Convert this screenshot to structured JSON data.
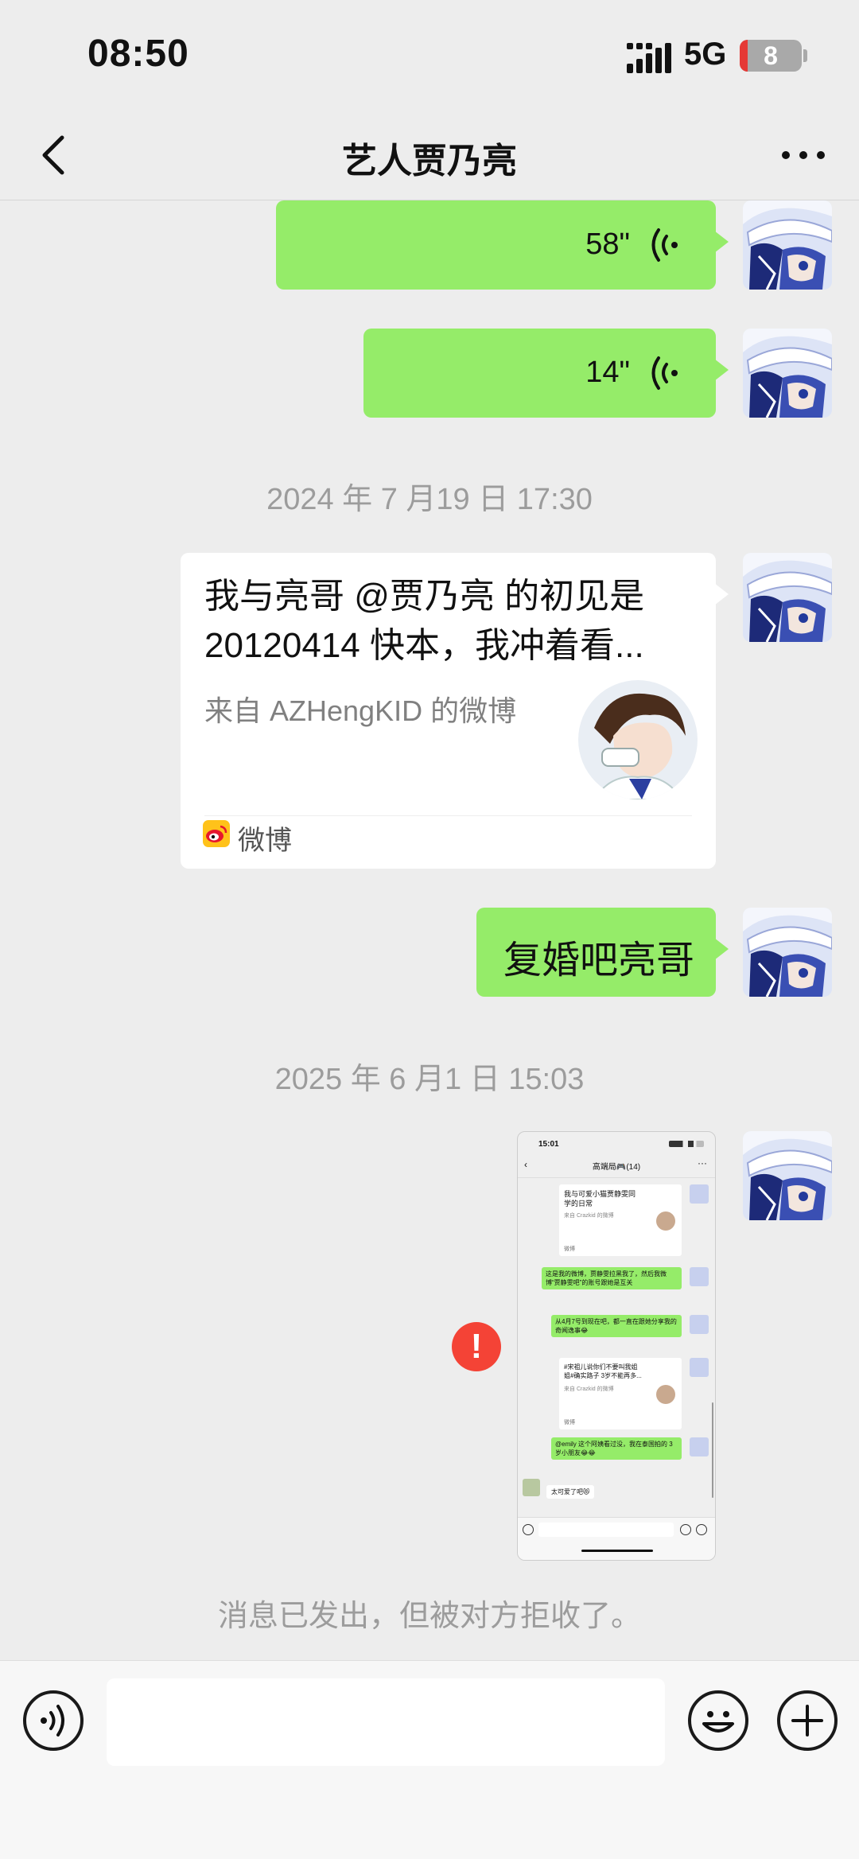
{
  "status_bar": {
    "time": "08:50",
    "network": "5G",
    "battery": "8"
  },
  "header": {
    "title": "艺人贾乃亮"
  },
  "messages": {
    "voice1": {
      "duration": "58\""
    },
    "voice2": {
      "duration": "14\""
    },
    "timestamp1": "2024 年 7 月19 日 17:30",
    "card": {
      "title": "我与亮哥 @贾乃亮 的初见是20120414 快本，我冲着看...",
      "source": "来自 AZHengKID 的微博",
      "app": "微博"
    },
    "text1": "复婚吧亮哥",
    "timestamp2": "2025 年 6 月1 日 15:03",
    "screenshot": {
      "time": "15:01",
      "title": "高端局🎮(14)",
      "card1_title": "我与可爱小猫贾静雯同学的日常",
      "card1_source": "来自 Crazkid 的微博",
      "card_app": "微博",
      "msg1": "这是我的微博，贾静雯拉黑我了，然后我微博“贾静雯吧”的账号跟她是互关",
      "msg2": "从4月7号到现在吧，都一直在跟她分享我的奇闻逸事😂",
      "card2_title": "#宋祖儿说你们不要叫我姐姐#确实路子 3岁不能再多...",
      "card2_source": "来自 Crazkid 的微博",
      "msg3": "@emily 这个阿姨看过没，我在泰国拍的 3岁小朋友😂😂",
      "reply": "太可爱了吧😻"
    },
    "error_mark": "!",
    "system_note": "消息已发出，但被对方拒收了。"
  },
  "colors": {
    "bubble_green": "#95ec69",
    "background": "#ededed",
    "error": "#f44336"
  }
}
